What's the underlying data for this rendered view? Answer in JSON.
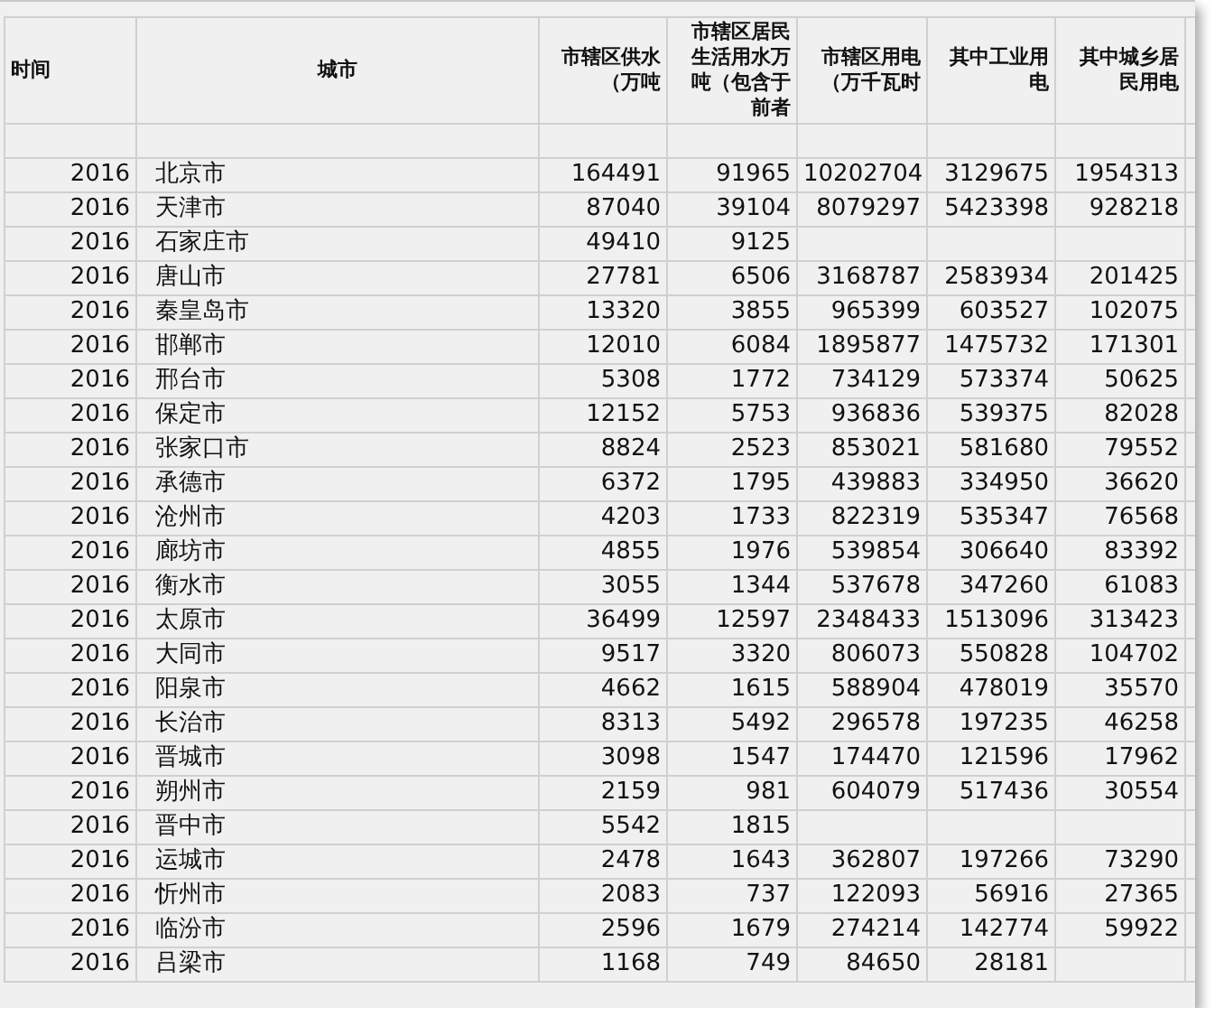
{
  "table": {
    "columns": [
      {
        "lines": [
          "时间"
        ]
      },
      {
        "lines": [
          "城市"
        ]
      },
      {
        "lines": [
          "市辖区供水",
          "（万吨"
        ]
      },
      {
        "lines": [
          "市辖区居民",
          "生活用水万",
          "吨（包含于",
          "前者"
        ]
      },
      {
        "lines": [
          "市辖区用电",
          "（万千瓦时"
        ]
      },
      {
        "lines": [
          "其中工业用",
          "电"
        ]
      },
      {
        "lines": [
          "其中城乡居",
          "民用电"
        ]
      }
    ],
    "rows": [
      {
        "time": "2016",
        "city": "北京市",
        "water_supply": "164491",
        "residential_water": "91965",
        "electricity": "10202704",
        "industrial_electricity": "3129675",
        "residential_electricity": "1954313"
      },
      {
        "time": "2016",
        "city": "天津市",
        "water_supply": "87040",
        "residential_water": "39104",
        "electricity": "8079297",
        "industrial_electricity": "5423398",
        "residential_electricity": "928218"
      },
      {
        "time": "2016",
        "city": "石家庄市",
        "water_supply": "49410",
        "residential_water": "9125"
      },
      {
        "time": "2016",
        "city": "唐山市",
        "water_supply": "27781",
        "residential_water": "6506",
        "electricity": "3168787",
        "industrial_electricity": "2583934",
        "residential_electricity": "201425"
      },
      {
        "time": "2016",
        "city": "秦皇岛市",
        "water_supply": "13320",
        "residential_water": "3855",
        "electricity": "965399",
        "industrial_electricity": "603527",
        "residential_electricity": "102075"
      },
      {
        "time": "2016",
        "city": "邯郸市",
        "water_supply": "12010",
        "residential_water": "6084",
        "electricity": "1895877",
        "industrial_electricity": "1475732",
        "residential_electricity": "171301"
      },
      {
        "time": "2016",
        "city": "邢台市",
        "water_supply": "5308",
        "residential_water": "1772",
        "electricity": "734129",
        "industrial_electricity": "573374",
        "residential_electricity": "50625"
      },
      {
        "time": "2016",
        "city": "保定市",
        "water_supply": "12152",
        "residential_water": "5753",
        "electricity": "936836",
        "industrial_electricity": "539375",
        "residential_electricity": "82028"
      },
      {
        "time": "2016",
        "city": "张家口市",
        "water_supply": "8824",
        "residential_water": "2523",
        "electricity": "853021",
        "industrial_electricity": "581680",
        "residential_electricity": "79552"
      },
      {
        "time": "2016",
        "city": "承德市",
        "water_supply": "6372",
        "residential_water": "1795",
        "electricity": "439883",
        "industrial_electricity": "334950",
        "residential_electricity": "36620"
      },
      {
        "time": "2016",
        "city": "沧州市",
        "water_supply": "4203",
        "residential_water": "1733",
        "electricity": "822319",
        "industrial_electricity": "535347",
        "residential_electricity": "76568"
      },
      {
        "time": "2016",
        "city": "廊坊市",
        "water_supply": "4855",
        "residential_water": "1976",
        "electricity": "539854",
        "industrial_electricity": "306640",
        "residential_electricity": "83392"
      },
      {
        "time": "2016",
        "city": "衡水市",
        "water_supply": "3055",
        "residential_water": "1344",
        "electricity": "537678",
        "industrial_electricity": "347260",
        "residential_electricity": "61083"
      },
      {
        "time": "2016",
        "city": "太原市",
        "water_supply": "36499",
        "residential_water": "12597",
        "electricity": "2348433",
        "industrial_electricity": "1513096",
        "residential_electricity": "313423"
      },
      {
        "time": "2016",
        "city": "大同市",
        "water_supply": "9517",
        "residential_water": "3320",
        "electricity": "806073",
        "industrial_electricity": "550828",
        "residential_electricity": "104702"
      },
      {
        "time": "2016",
        "city": "阳泉市",
        "water_supply": "4662",
        "residential_water": "1615",
        "electricity": "588904",
        "industrial_electricity": "478019",
        "residential_electricity": "35570"
      },
      {
        "time": "2016",
        "city": "长治市",
        "water_supply": "8313",
        "residential_water": "5492",
        "electricity": "296578",
        "industrial_electricity": "197235",
        "residential_electricity": "46258"
      },
      {
        "time": "2016",
        "city": "晋城市",
        "water_supply": "3098",
        "residential_water": "1547",
        "electricity": "174470",
        "industrial_electricity": "121596",
        "residential_electricity": "17962"
      },
      {
        "time": "2016",
        "city": "朔州市",
        "water_supply": "2159",
        "residential_water": "981",
        "electricity": "604079",
        "industrial_electricity": "517436",
        "residential_electricity": "30554"
      },
      {
        "time": "2016",
        "city": "晋中市",
        "water_supply": "5542",
        "residential_water": "1815"
      },
      {
        "time": "2016",
        "city": "运城市",
        "water_supply": "2478",
        "residential_water": "1643",
        "electricity": "362807",
        "industrial_electricity": "197266",
        "residential_electricity": "73290"
      },
      {
        "time": "2016",
        "city": "忻州市",
        "water_supply": "2083",
        "residential_water": "737",
        "electricity": "122093",
        "industrial_electricity": "56916",
        "residential_electricity": "27365"
      },
      {
        "time": "2016",
        "city": "临汾市",
        "water_supply": "2596",
        "residential_water": "1679",
        "electricity": "274214",
        "industrial_electricity": "142774",
        "residential_electricity": "59922"
      },
      {
        "time": "2016",
        "city": "吕梁市",
        "water_supply": "1168",
        "residential_water": "749",
        "electricity": "84650",
        "industrial_electricity": "28181"
      }
    ]
  }
}
